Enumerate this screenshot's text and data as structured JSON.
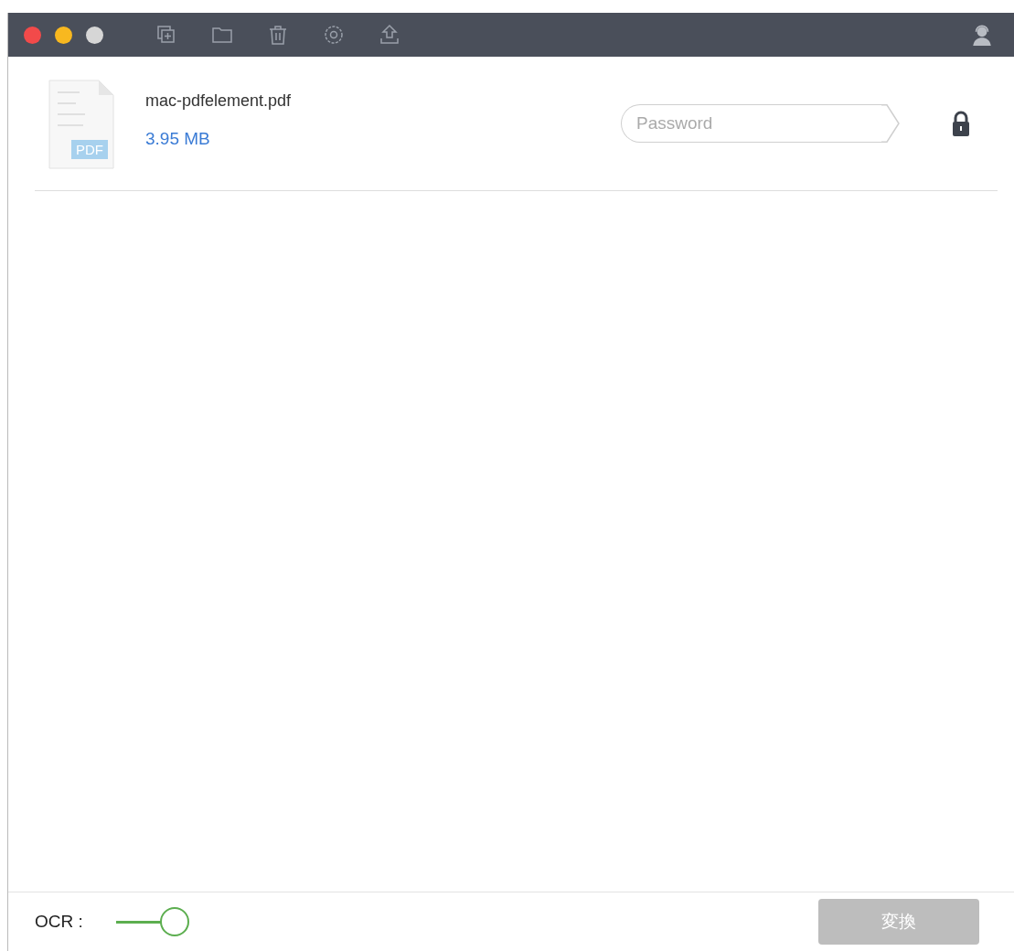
{
  "files": [
    {
      "name": "mac-pdfelement.pdf",
      "badge": "PDF",
      "size": "3.95 MB",
      "password": {
        "placeholder": "Password"
      }
    }
  ],
  "footer": {
    "ocr_label": "OCR :",
    "ocr_toggle": {
      "on": true
    },
    "convert_button": {
      "label": "変換",
      "disabled": true
    }
  }
}
